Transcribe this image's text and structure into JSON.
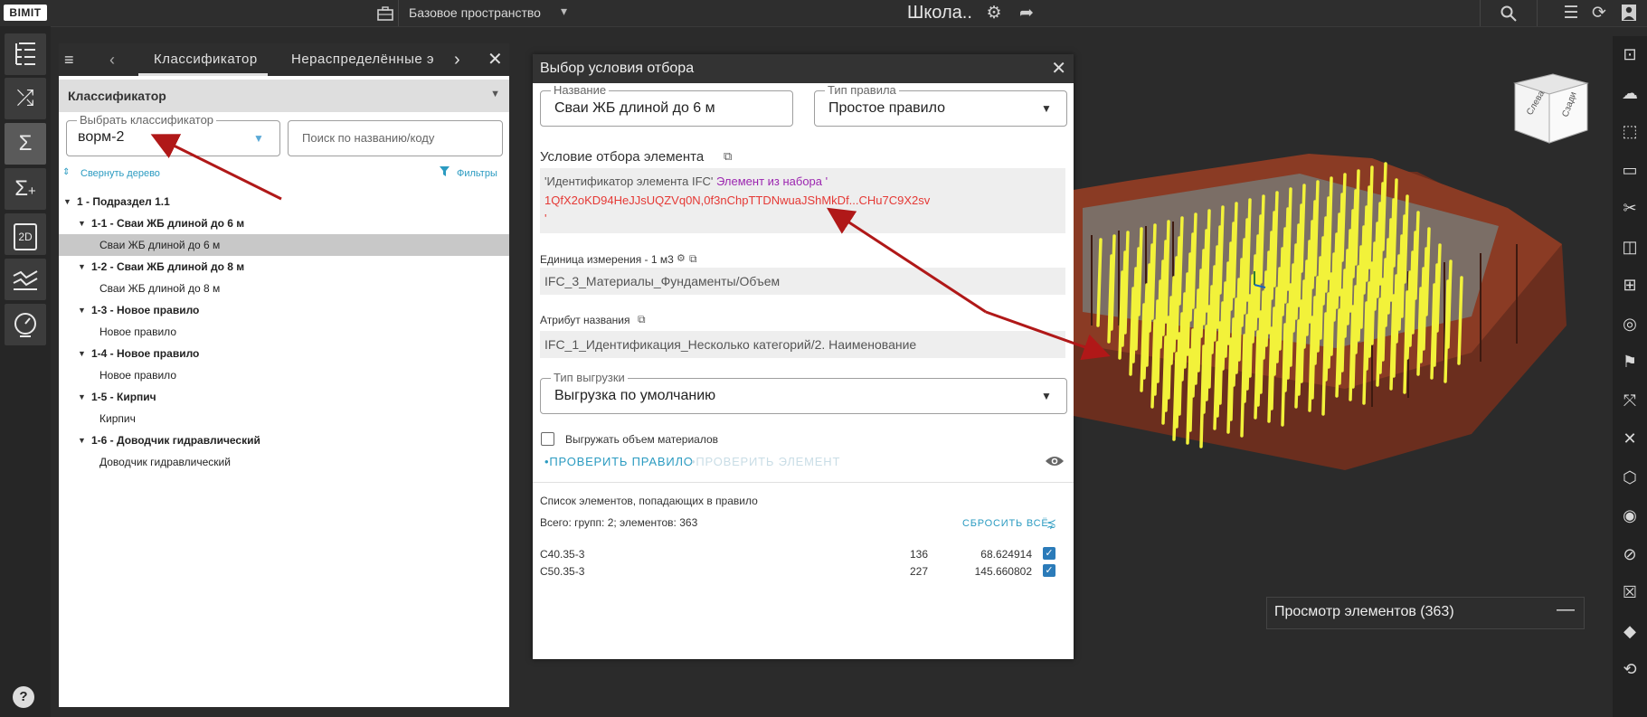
{
  "topbar": {
    "logo": "BIMIT",
    "space": "Базовое пространство",
    "project_title": "Школа..",
    "icons": [
      "briefcase-icon",
      "chevron-down-icon",
      "gear-icon",
      "share-icon",
      "search-icon",
      "list-icon",
      "sync-icon",
      "user-icon"
    ]
  },
  "left_rail": {
    "tools": [
      "tree-icon",
      "shuffle-icon",
      "sigma-icon",
      "sigma-plus-icon",
      "2d-icon",
      "chart-icon",
      "gauge-icon"
    ],
    "label_2d": "2D",
    "help": "?"
  },
  "classifier_panel": {
    "tabs": [
      "Классификатор",
      "Нераспределённые э"
    ],
    "header": "Классификатор",
    "select_label": "Выбрать классификатор",
    "select_value": "ворм-2",
    "search_placeholder": "Поиск по названию/коду",
    "collapse_label": "Свернуть дерево",
    "filters_label": "Фильтры",
    "tree": [
      {
        "label": "1 - Подраздел 1.1",
        "bold": true,
        "level": 0
      },
      {
        "label": "1-1 - Сваи ЖБ длиной до 6 м",
        "bold": true,
        "level": 1
      },
      {
        "label": "Сваи ЖБ длиной до 6 м",
        "bold": false,
        "level": 2,
        "selected": true
      },
      {
        "label": "1-2 - Сваи ЖБ длиной до 8 м",
        "bold": true,
        "level": 1
      },
      {
        "label": "Сваи ЖБ длиной до 8 м",
        "bold": false,
        "level": 2
      },
      {
        "label": "1-3 - Новое правило",
        "bold": true,
        "level": 1
      },
      {
        "label": "Новое правило",
        "bold": false,
        "level": 2
      },
      {
        "label": "1-4 - Новое правило",
        "bold": true,
        "level": 1
      },
      {
        "label": "Новое правило",
        "bold": false,
        "level": 2
      },
      {
        "label": "1-5 - Кирпич",
        "bold": true,
        "level": 1
      },
      {
        "label": "Кирпич",
        "bold": false,
        "level": 2
      },
      {
        "label": "1-6 - Доводчик гидравлический",
        "bold": true,
        "level": 1
      },
      {
        "label": "Доводчик гидравлический",
        "bold": false,
        "level": 2
      }
    ]
  },
  "dialog": {
    "title": "Выбор условия отбора",
    "name_label": "Название",
    "name_value": "Сваи ЖБ длиной до 6 м",
    "rule_type_label": "Тип правила",
    "rule_type_value": "Простое правило",
    "condition_title": "Условие отбора элемента",
    "condition_part1": "'Идентификатор элемента IFC'",
    "condition_part2": "Элемент из набора '",
    "condition_ids": "1QfX2oKD94HeJJsUQZVq0N,0f3nChpTTDNwuaJShMkDf...CHu7C9X2sv",
    "condition_end": "'",
    "unit_label": "Единица измерения - 1 м3",
    "unit_value": "IFC_3_Материалы_Фундаменты/Объем",
    "name_attr_label": "Атрибут названия",
    "name_attr_value": "IFC_1_Идентификация_Несколько категорий/2. Наименование",
    "export_type_label": "Тип выгрузки",
    "export_type_value": "Выгрузка по умолчанию",
    "export_volume_label": "Выгружать объем материалов",
    "check_rule": "ПРОВЕРИТЬ ПРАВИЛО",
    "check_element": "ПРОВЕРИТЬ ЭЛЕМЕНТ",
    "list_title": "Список элементов, попадающих в правило",
    "totals": "Всего: групп: 2; элементов: 363",
    "reset_all": "СБРОСИТЬ ВСЁ",
    "rows": [
      {
        "name": "C40.35-3",
        "count": "136",
        "value": "68.624914",
        "checked": true
      },
      {
        "name": "C50.35-3",
        "count": "227",
        "value": "145.660802",
        "checked": true
      }
    ]
  },
  "viewport": {
    "cube_faces": [
      "Слева",
      "Сзади"
    ],
    "preview_title": "Просмотр элементов (363)"
  },
  "right_rail": {
    "tools": [
      "focus-icon",
      "cloud-icon",
      "select-icon",
      "ruler-icon",
      "cut-icon",
      "section-icon",
      "fit-icon",
      "target-icon",
      "flag-icon",
      "transform-icon",
      "crosshair-icon",
      "cube-icon",
      "eye-icon",
      "eye-off-icon",
      "box-x-icon",
      "solid-cube-icon",
      "orbit-icon"
    ]
  },
  "colors": {
    "accent": "#2b9bc1",
    "highlight_yellow": "#f2f23a",
    "condition_red": "#e53935",
    "condition_purple": "#9c27b0",
    "arrow_red": "#b01818"
  }
}
